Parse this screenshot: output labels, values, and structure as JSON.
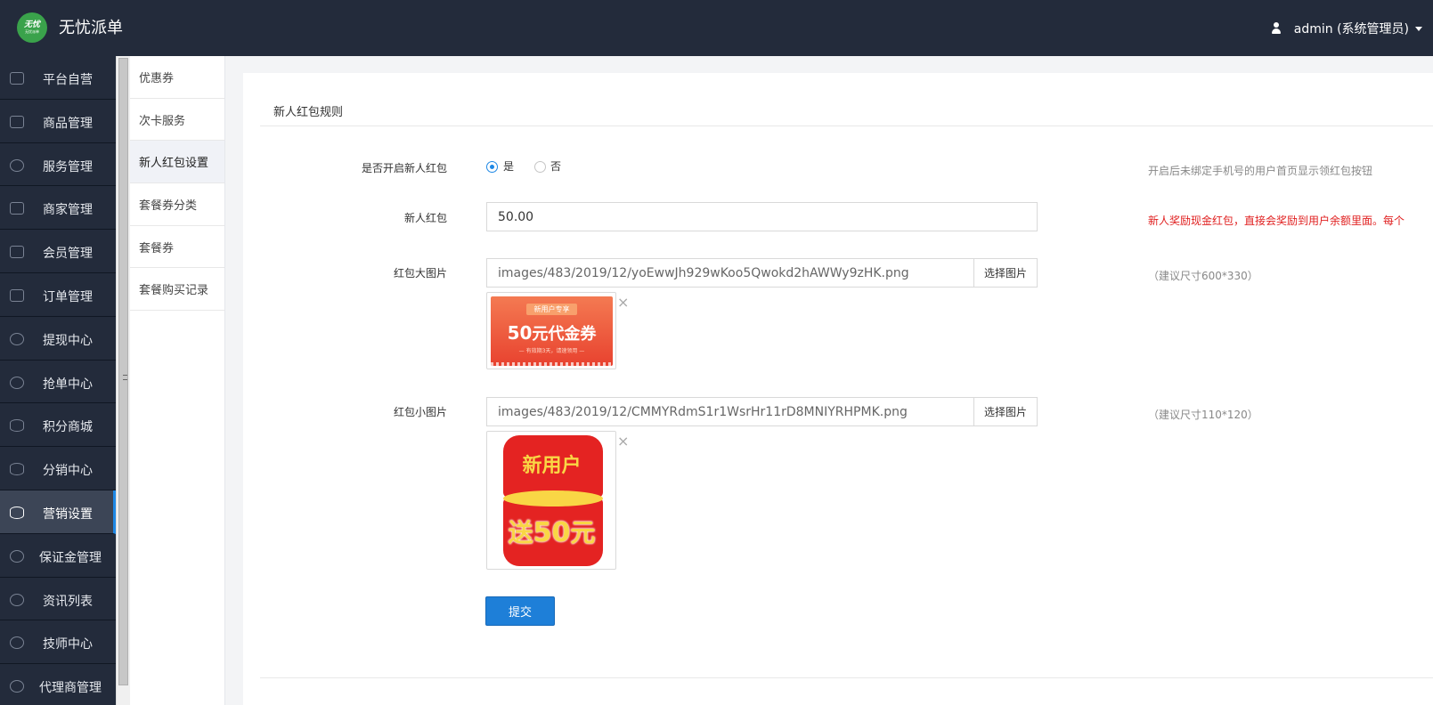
{
  "header": {
    "app_title": "无忧派单",
    "logo_text": "无忧",
    "logo_subtext": "无忧派单",
    "user": "admin (系统管理员)"
  },
  "sidebar": {
    "items": [
      {
        "label": "平台自营",
        "icon": "monitor-icon"
      },
      {
        "label": "商品管理",
        "icon": "box-icon"
      },
      {
        "label": "服务管理",
        "icon": "heart-icon"
      },
      {
        "label": "商家管理",
        "icon": "store-icon"
      },
      {
        "label": "会员管理",
        "icon": "diamond-icon"
      },
      {
        "label": "订单管理",
        "icon": "list-icon"
      },
      {
        "label": "提现中心",
        "icon": "money-bag-icon"
      },
      {
        "label": "抢单中心",
        "icon": "money-bag-icon"
      },
      {
        "label": "积分商城",
        "icon": "database-icon"
      },
      {
        "label": "分销中心",
        "icon": "database-icon"
      },
      {
        "label": "营销设置",
        "icon": "database-icon",
        "active": true
      },
      {
        "label": "保证金管理",
        "icon": "shield-icon"
      },
      {
        "label": "资讯列表",
        "icon": "shield-icon"
      },
      {
        "label": "技师中心",
        "icon": "shield-icon"
      },
      {
        "label": "代理商管理",
        "icon": "shield-icon"
      }
    ]
  },
  "subnav": {
    "items": [
      {
        "label": "优惠券"
      },
      {
        "label": "次卡服务"
      },
      {
        "label": "新人红包设置",
        "active": true
      },
      {
        "label": "套餐券分类"
      },
      {
        "label": "套餐券"
      },
      {
        "label": "套餐购买记录"
      }
    ]
  },
  "form": {
    "title": "新人红包规则",
    "enable": {
      "label": "是否开启新人红包",
      "yes": "是",
      "no": "否",
      "selected": "是",
      "help": "开启后未绑定手机号的用户首页显示领红包按钮"
    },
    "amount": {
      "label": "新人红包",
      "value": "50.00",
      "help": "新人奖励现金红包，直接会奖励到用户余额里面。每个"
    },
    "big_image": {
      "label": "红包大图片",
      "path": "images/483/2019/12/yoEwwJh929wKoo5Qwokd2hAWWy9zHK.png",
      "button": "选择图片",
      "help": "（建议尺寸600*330）",
      "preview": {
        "tag": "新用户专享",
        "amount": "50",
        "text": "元代金券",
        "note": "— 有效期3天，请速领用 —"
      }
    },
    "small_image": {
      "label": "红包小图片",
      "path": "images/483/2019/12/CMMYRdmS1r1WsrHr11rD8MNIYRHPMK.png",
      "button": "选择图片",
      "help": "（建议尺寸110*120）",
      "preview": {
        "line1": "新用户",
        "line2_prefix": "送",
        "line2_amount": "50",
        "line2_suffix": "元"
      }
    },
    "remove_glyph": "×",
    "submit": "提交"
  }
}
